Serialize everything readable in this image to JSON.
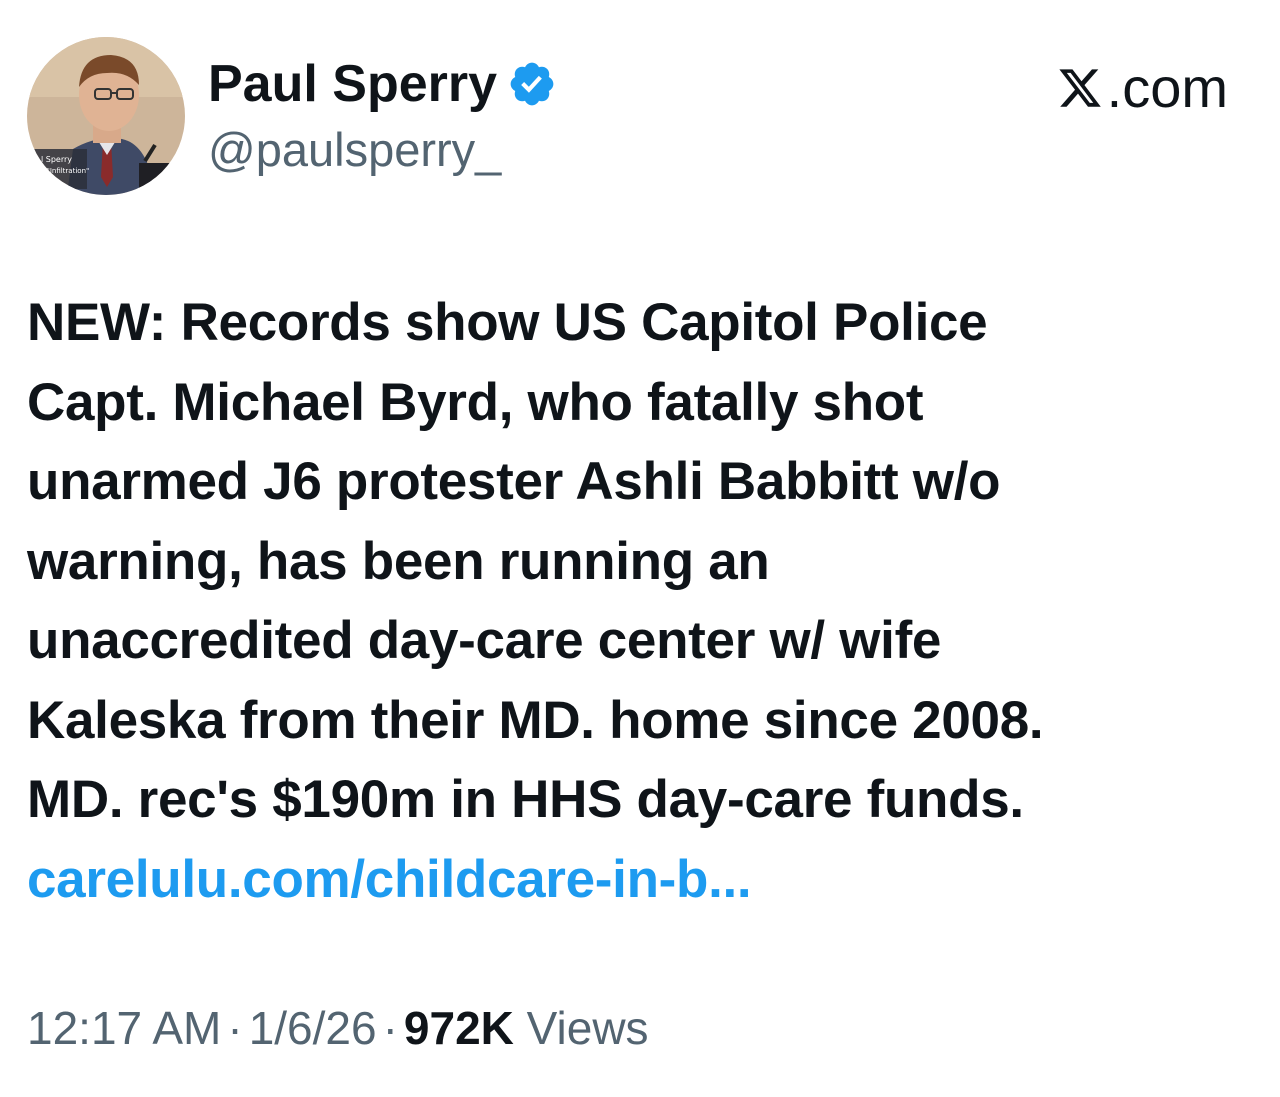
{
  "author": {
    "name": "Paul Sperry",
    "handle": "@paulsperry_",
    "verified": true,
    "avatar_caption_line1": "l Sperry",
    "avatar_caption_line2": "or, \"Infiltration\""
  },
  "site": {
    "label": ".com",
    "icon": "x-logo-icon"
  },
  "tweet": {
    "lines": [
      "NEW: Records show US Capitol Police",
      "Capt. Michael Byrd, who fatally shot",
      "unarmed J6 protester Ashli Babbitt w/o",
      "warning, has been running an",
      "unaccredited day-care center w/ wife",
      "Kaleska from their MD. home since 2008.",
      "MD. rec's $190m in HHS day-care funds."
    ],
    "link_text": "carelulu.com/childcare-in-b..."
  },
  "meta": {
    "time": "12:17 AM",
    "date": "1/6/26",
    "separator": "·",
    "views_count": "972K",
    "views_label": "Views"
  },
  "colors": {
    "text": "#0f1419",
    "secondary": "#536471",
    "link": "#1d9bf0",
    "verified": "#1d9bf0"
  }
}
